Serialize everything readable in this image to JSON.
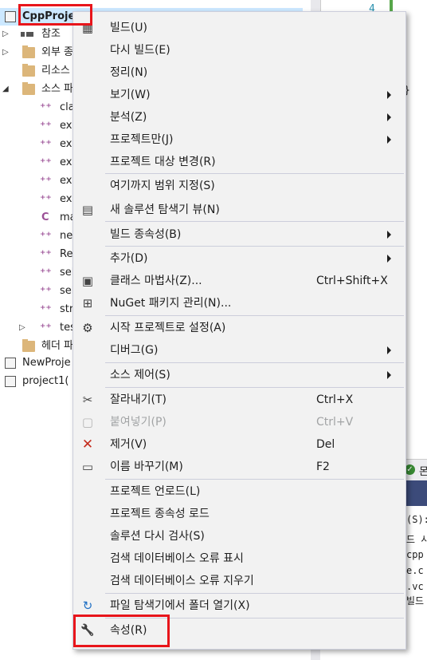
{
  "explorer": {
    "project_name": "CppProject",
    "items": [
      {
        "label": "참조"
      },
      {
        "label": "외부 종"
      },
      {
        "label": "리소스"
      },
      {
        "label": "소스 파"
      },
      {
        "label": "cla"
      },
      {
        "label": "ex"
      },
      {
        "label": "ex"
      },
      {
        "label": "ex"
      },
      {
        "label": "ex"
      },
      {
        "label": "ex"
      },
      {
        "label": "ma"
      },
      {
        "label": "ne"
      },
      {
        "label": "Re"
      },
      {
        "label": "sel"
      },
      {
        "label": "sel"
      },
      {
        "label": "str"
      },
      {
        "label": "tes"
      },
      {
        "label": "헤더 파"
      }
    ],
    "other_projects": [
      "NewProje",
      "project1("
    ]
  },
  "editor": {
    "line_number": "4",
    "brace": "}"
  },
  "output": {
    "header_text": "몬",
    "lines": [
      "(S):",
      "드 시",
      "cpp",
      "e.c",
      ".vc",
      "빌드"
    ]
  },
  "menu": {
    "items": [
      {
        "label": "빌드(U)",
        "icon": "build-icon"
      },
      {
        "label": "다시 빌드(E)"
      },
      {
        "label": "정리(N)"
      },
      {
        "label": "보기(W)",
        "submenu": true
      },
      {
        "label": "분석(Z)",
        "submenu": true
      },
      {
        "label": "프로젝트만(J)",
        "submenu": true
      },
      {
        "label": "프로젝트 대상 변경(R)"
      },
      {
        "label": "여기까지 범위 지정(S)"
      },
      {
        "label": "새 솔루션 탐색기 뷰(N)",
        "icon": "new-view-icon"
      },
      {
        "label": "빌드 종속성(B)",
        "submenu": true
      },
      {
        "label": "추가(D)",
        "submenu": true
      },
      {
        "label": "클래스 마법사(Z)...",
        "shortcut": "Ctrl+Shift+X",
        "icon": "class-wizard-icon"
      },
      {
        "label": "NuGet 패키지 관리(N)...",
        "icon": "nuget-icon"
      },
      {
        "label": "시작 프로젝트로 설정(A)",
        "icon": "gear-icon"
      },
      {
        "label": "디버그(G)",
        "submenu": true
      },
      {
        "label": "소스 제어(S)",
        "submenu": true
      },
      {
        "label": "잘라내기(T)",
        "shortcut": "Ctrl+X",
        "icon": "scissors-icon"
      },
      {
        "label": "붙여넣기(P)",
        "shortcut": "Ctrl+V",
        "icon": "paste-icon",
        "disabled": true
      },
      {
        "label": "제거(V)",
        "shortcut": "Del",
        "icon": "delete-icon"
      },
      {
        "label": "이름 바꾸기(M)",
        "shortcut": "F2",
        "icon": "rename-icon"
      },
      {
        "label": "프로젝트 언로드(L)"
      },
      {
        "label": "프로젝트 종속성 로드"
      },
      {
        "label": "솔루션 다시 검사(S)"
      },
      {
        "label": "검색 데이터베이스 오류 표시"
      },
      {
        "label": "검색 데이터베이스 오류 지우기"
      },
      {
        "label": "파일 탐색기에서 폴더 열기(X)",
        "icon": "open-folder-icon"
      },
      {
        "label": "속성(R)",
        "icon": "wrench-icon"
      }
    ]
  },
  "colors": {
    "highlight": "#e8151b",
    "menu_bg": "#f2f2f2",
    "separator": "#cccedb"
  }
}
